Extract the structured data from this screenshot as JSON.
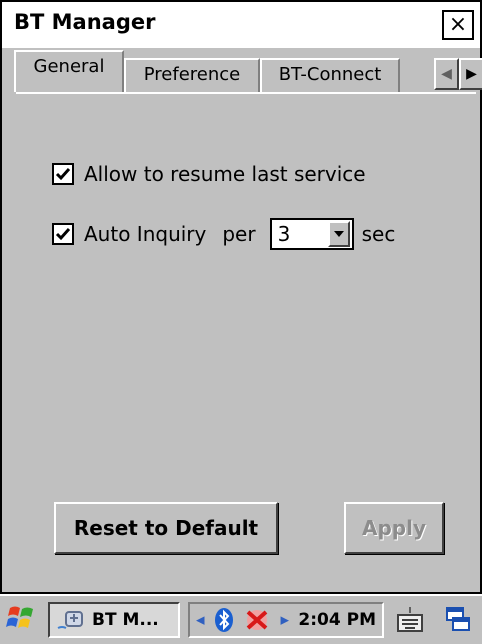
{
  "window": {
    "title": "BT Manager",
    "close_label": "×"
  },
  "tabs": [
    {
      "label": "General",
      "active": true
    },
    {
      "label": "Preference",
      "active": false
    },
    {
      "label": "BT-Connect",
      "active": false
    }
  ],
  "options": {
    "resume": {
      "label": "Allow to resume last service",
      "checked": true
    },
    "inquiry": {
      "label": "Auto Inquiry",
      "checked": true,
      "per_label": "per",
      "interval_value": "3",
      "unit_label": "sec"
    }
  },
  "buttons": {
    "reset_label": "Reset to Default",
    "apply_label": "Apply",
    "apply_enabled": false
  },
  "taskbar": {
    "task_label": "BT M...",
    "time": "2:04 PM"
  }
}
